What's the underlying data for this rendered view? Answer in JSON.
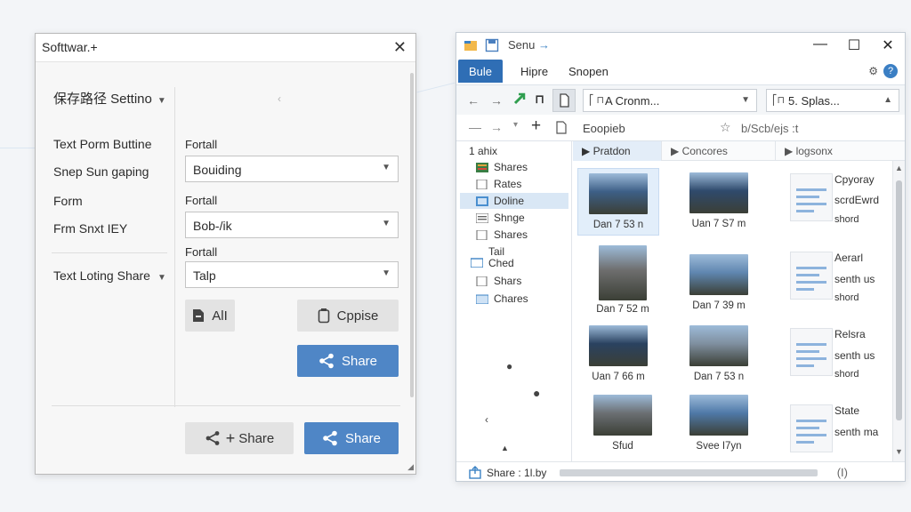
{
  "dialog": {
    "title": "Softtwar.+",
    "section_header": "保存路径 Settino",
    "nav_items": [
      "Text Porm Buttine",
      "Snep Sun gaping",
      "Form",
      "Frm Snxt IEY",
      "Text Loting Share"
    ],
    "fields": [
      {
        "label": "Fortall",
        "value": "Bouiding"
      },
      {
        "label": "Fortall",
        "value": "Bob-/ik"
      },
      {
        "label": "Fortall",
        "value": "Talp"
      }
    ],
    "buttons": {
      "alt": "AlI",
      "copy": "Cppise",
      "share_primary": "Share",
      "share_secondary": "Share",
      "share_footer": "Share"
    }
  },
  "explorer": {
    "title": "Senu",
    "ribbon_tabs": [
      "Bule",
      "Hipre",
      "Snopen"
    ],
    "address_left": "A Cronm...",
    "address_right": "5. Splas...",
    "toolbar_text": "Eoopieb",
    "search_text": "b/Scb/ejs :t",
    "sidebar_header": "1 ahix",
    "sidebar_items": [
      "Shares",
      "Rates",
      "Doline",
      "Shnge",
      "Shares",
      "Tail Ched",
      "Shars",
      "Chares"
    ],
    "column_headers": [
      "Pratdon",
      "Concores",
      "logsonx"
    ],
    "thumbnails": [
      {
        "caption": "Dan 7 53 n",
        "color": "#3d5f86"
      },
      {
        "caption": "Uan 7 S7 m",
        "color": "#2f4a6c"
      },
      {
        "caption": "Dan 7 52 m",
        "color": "#6e6e6e"
      },
      {
        "caption": "Dan 7 39 m",
        "color": "#5f86b0"
      },
      {
        "caption": "Uan 7 66 m",
        "color": "#2a4260"
      },
      {
        "caption": "Dan 7 53 n",
        "color": "#7f8f9f"
      },
      {
        "caption": "Sfud",
        "color": "#6b6f73"
      },
      {
        "caption": "Svee I7yn",
        "color": "#4f79a8"
      }
    ],
    "documents": [
      {
        "title": "Cpyoray",
        "line2": "scrdEwrd",
        "line3": "shord"
      },
      {
        "title": "Aerarl",
        "line2": "senth us",
        "line3": "shord"
      },
      {
        "title": "Relsra",
        "line2": "senth us",
        "line3": "shord"
      },
      {
        "title": "State",
        "line2": "senth ma",
        "line3": ""
      }
    ],
    "status_text": "Share : 1l.by",
    "status_end": "(I)"
  }
}
